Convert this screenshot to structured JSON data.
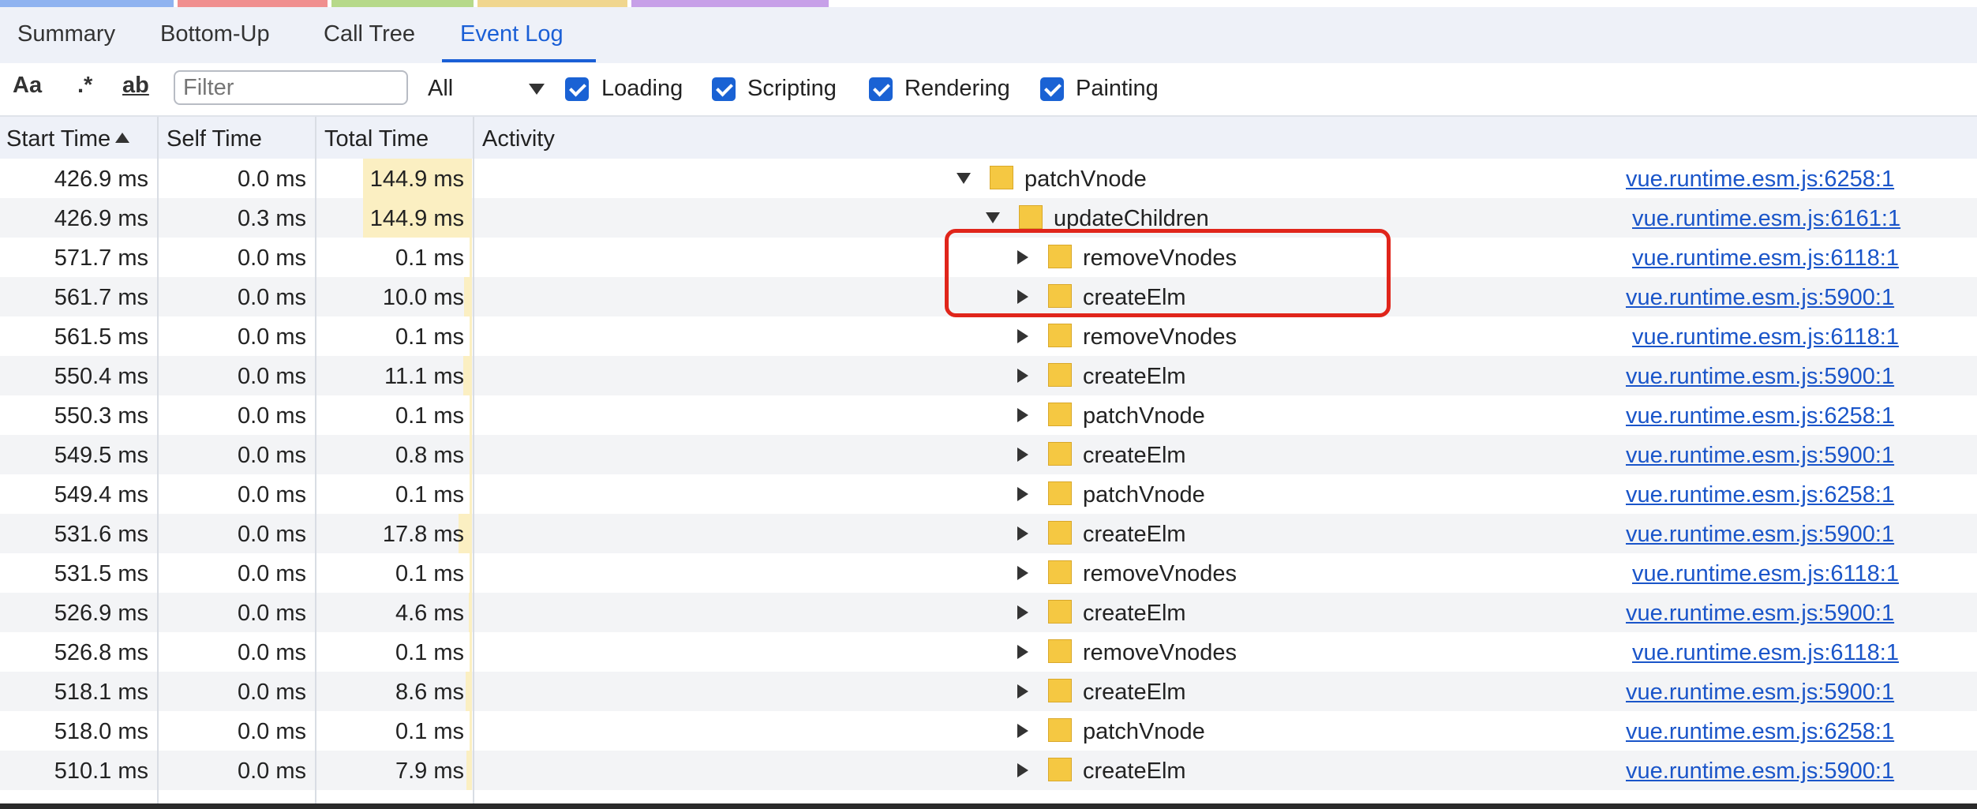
{
  "legend_strip": {
    "segments": [
      {
        "color": "#8fb3f0"
      },
      {
        "color": "#f08f8f"
      },
      {
        "color": "#b6d98a"
      },
      {
        "color": "#f0d68f"
      },
      {
        "color": "#c7a0e8"
      }
    ]
  },
  "tabs": [
    {
      "label": "Summary",
      "active": false
    },
    {
      "label": "Bottom-Up",
      "active": false
    },
    {
      "label": "Call Tree",
      "active": false
    },
    {
      "label": "Event Log",
      "active": true
    }
  ],
  "toolbar": {
    "match_case_label": "Aa",
    "regex_label": ".*",
    "whole_word_label": "ab",
    "filter_placeholder": "Filter",
    "category_select_value": "All",
    "checkboxes": [
      {
        "label": "Loading",
        "checked": true
      },
      {
        "label": "Scripting",
        "checked": true
      },
      {
        "label": "Rendering",
        "checked": true
      },
      {
        "label": "Painting",
        "checked": true
      }
    ]
  },
  "columns": {
    "start_time": "Start Time",
    "self_time": "Self Time",
    "total_time": "Total Time",
    "activity": "Activity"
  },
  "rows": [
    {
      "start": "426.9 ms",
      "self": "0.0 ms",
      "total": "144.9 ms",
      "total_fill": 1.0,
      "depth": 0,
      "expanded": true,
      "activity": "patchVnode",
      "source": "vue.runtime.esm.js:6258:1"
    },
    {
      "start": "426.9 ms",
      "self": "0.3 ms",
      "total": "144.9 ms",
      "total_fill": 1.0,
      "depth": 1,
      "expanded": true,
      "activity": "updateChildren",
      "source": "vue.runtime.esm.js:6161:1"
    },
    {
      "start": "571.7 ms",
      "self": "0.0 ms",
      "total": "0.1 ms",
      "total_fill": 0.0,
      "depth": 2,
      "expanded": false,
      "activity": "removeVnodes",
      "source": "vue.runtime.esm.js:6118:1"
    },
    {
      "start": "561.7 ms",
      "self": "0.0 ms",
      "total": "10.0 ms",
      "total_fill": 0.07,
      "depth": 2,
      "expanded": false,
      "activity": "createElm",
      "source": "vue.runtime.esm.js:5900:1"
    },
    {
      "start": "561.5 ms",
      "self": "0.0 ms",
      "total": "0.1 ms",
      "total_fill": 0.0,
      "depth": 2,
      "expanded": false,
      "activity": "removeVnodes",
      "source": "vue.runtime.esm.js:6118:1"
    },
    {
      "start": "550.4 ms",
      "self": "0.0 ms",
      "total": "11.1 ms",
      "total_fill": 0.08,
      "depth": 2,
      "expanded": false,
      "activity": "createElm",
      "source": "vue.runtime.esm.js:5900:1"
    },
    {
      "start": "550.3 ms",
      "self": "0.0 ms",
      "total": "0.1 ms",
      "total_fill": 0.0,
      "depth": 2,
      "expanded": false,
      "activity": "patchVnode",
      "source": "vue.runtime.esm.js:6258:1"
    },
    {
      "start": "549.5 ms",
      "self": "0.0 ms",
      "total": "0.8 ms",
      "total_fill": 0.01,
      "depth": 2,
      "expanded": false,
      "activity": "createElm",
      "source": "vue.runtime.esm.js:5900:1"
    },
    {
      "start": "549.4 ms",
      "self": "0.0 ms",
      "total": "0.1 ms",
      "total_fill": 0.0,
      "depth": 2,
      "expanded": false,
      "activity": "patchVnode",
      "source": "vue.runtime.esm.js:6258:1"
    },
    {
      "start": "531.6 ms",
      "self": "0.0 ms",
      "total": "17.8 ms",
      "total_fill": 0.12,
      "depth": 2,
      "expanded": false,
      "activity": "createElm",
      "source": "vue.runtime.esm.js:5900:1"
    },
    {
      "start": "531.5 ms",
      "self": "0.0 ms",
      "total": "0.1 ms",
      "total_fill": 0.0,
      "depth": 2,
      "expanded": false,
      "activity": "removeVnodes",
      "source": "vue.runtime.esm.js:6118:1"
    },
    {
      "start": "526.9 ms",
      "self": "0.0 ms",
      "total": "4.6 ms",
      "total_fill": 0.03,
      "depth": 2,
      "expanded": false,
      "activity": "createElm",
      "source": "vue.runtime.esm.js:5900:1"
    },
    {
      "start": "526.8 ms",
      "self": "0.0 ms",
      "total": "0.1 ms",
      "total_fill": 0.0,
      "depth": 2,
      "expanded": false,
      "activity": "removeVnodes",
      "source": "vue.runtime.esm.js:6118:1"
    },
    {
      "start": "518.1 ms",
      "self": "0.0 ms",
      "total": "8.6 ms",
      "total_fill": 0.06,
      "depth": 2,
      "expanded": false,
      "activity": "createElm",
      "source": "vue.runtime.esm.js:5900:1"
    },
    {
      "start": "518.0 ms",
      "self": "0.0 ms",
      "total": "0.1 ms",
      "total_fill": 0.0,
      "depth": 2,
      "expanded": false,
      "activity": "patchVnode",
      "source": "vue.runtime.esm.js:6258:1"
    },
    {
      "start": "510.1 ms",
      "self": "0.0 ms",
      "total": "7.9 ms",
      "total_fill": 0.05,
      "depth": 2,
      "expanded": false,
      "activity": "createElm",
      "source": "vue.runtime.esm.js:5900:1"
    }
  ]
}
